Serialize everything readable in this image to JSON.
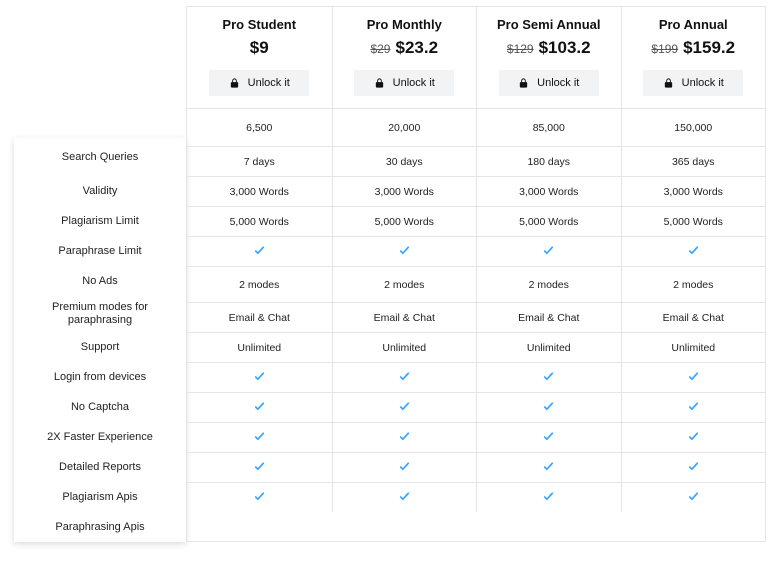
{
  "labels": [
    "Search Queries",
    "Validity",
    "Plagiarism Limit",
    "Paraphrase Limit",
    "No Ads",
    "Premium modes for paraphrasing",
    "Support",
    "Login from devices",
    "No Captcha",
    "2X Faster Experience",
    "Detailed Reports",
    "Plagiarism Apis",
    "Paraphrasing Apis"
  ],
  "unlock_label": "Unlock it",
  "plans": [
    {
      "name": "Pro Student",
      "orig_price": "",
      "price": "$9",
      "values": [
        "6,500",
        "7 days",
        "3,000 Words",
        "5,000 Words",
        "check",
        "2 modes",
        "Email & Chat",
        "Unlimited",
        "check",
        "check",
        "check",
        "check",
        "check"
      ]
    },
    {
      "name": "Pro Monthly",
      "orig_price": "$29",
      "price": "$23.2",
      "values": [
        "20,000",
        "30 days",
        "3,000 Words",
        "5,000 Words",
        "check",
        "2 modes",
        "Email & Chat",
        "Unlimited",
        "check",
        "check",
        "check",
        "check",
        "check"
      ]
    },
    {
      "name": "Pro Semi Annual",
      "orig_price": "$129",
      "price": "$103.2",
      "values": [
        "85,000",
        "180 days",
        "3,000 Words",
        "5,000 Words",
        "check",
        "2 modes",
        "Email & Chat",
        "Unlimited",
        "check",
        "check",
        "check",
        "check",
        "check"
      ]
    },
    {
      "name": "Pro Annual",
      "orig_price": "$199",
      "price": "$159.2",
      "values": [
        "150,000",
        "365 days",
        "3,000 Words",
        "5,000 Words",
        "check",
        "2 modes",
        "Email & Chat",
        "Unlimited",
        "check",
        "check",
        "check",
        "check",
        "check"
      ]
    }
  ]
}
